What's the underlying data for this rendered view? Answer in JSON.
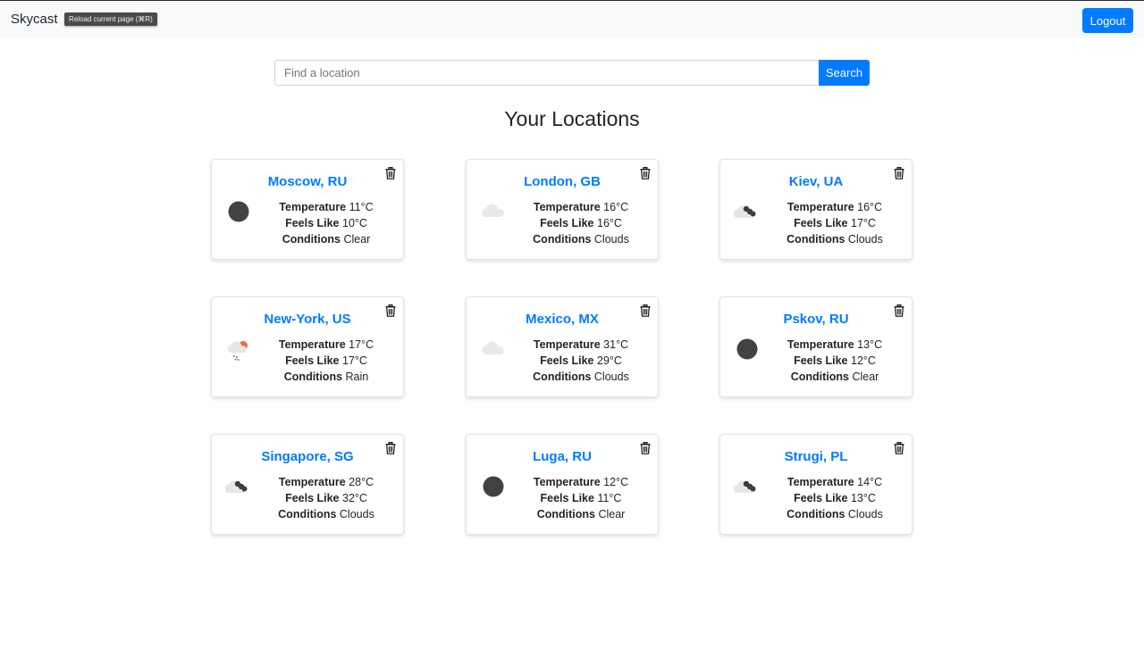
{
  "app": {
    "brand": "Skycast",
    "tooltip": "Reload current page (⌘R)",
    "logout_label": "Logout"
  },
  "search": {
    "placeholder": "Find a location",
    "value": "",
    "button_label": "Search"
  },
  "heading": "Your Locations",
  "labels": {
    "temperature": "Temperature",
    "feels_like": "Feels Like",
    "conditions": "Conditions"
  },
  "colors": {
    "accent": "#007bff",
    "navbar_bg": "#f8f9fa"
  },
  "locations": [
    {
      "name": "Moscow, RU",
      "temperature": "11°C",
      "feels_like": "10°C",
      "conditions": "Clear",
      "icon": "clear-night-icon"
    },
    {
      "name": "London, GB",
      "temperature": "16°C",
      "feels_like": "16°C",
      "conditions": "Clouds",
      "icon": "cloud-icon"
    },
    {
      "name": "Kiev, UA",
      "temperature": "16°C",
      "feels_like": "17°C",
      "conditions": "Clouds",
      "icon": "broken-clouds-icon"
    },
    {
      "name": "New-York, US",
      "temperature": "17°C",
      "feels_like": "17°C",
      "conditions": "Rain",
      "icon": "rain-icon"
    },
    {
      "name": "Mexico, MX",
      "temperature": "31°C",
      "feels_like": "29°C",
      "conditions": "Clouds",
      "icon": "cloud-icon"
    },
    {
      "name": "Pskov, RU",
      "temperature": "13°C",
      "feels_like": "12°C",
      "conditions": "Clear",
      "icon": "clear-night-icon"
    },
    {
      "name": "Singapore, SG",
      "temperature": "28°C",
      "feels_like": "32°C",
      "conditions": "Clouds",
      "icon": "broken-clouds-icon"
    },
    {
      "name": "Luga, RU",
      "temperature": "12°C",
      "feels_like": "11°C",
      "conditions": "Clear",
      "icon": "clear-night-icon"
    },
    {
      "name": "Strugi, PL",
      "temperature": "14°C",
      "feels_like": "13°C",
      "conditions": "Clouds",
      "icon": "broken-clouds-icon"
    }
  ]
}
